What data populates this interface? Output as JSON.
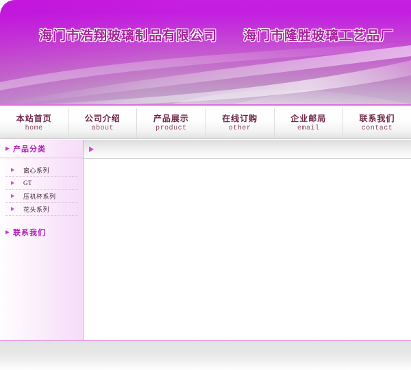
{
  "banner": {
    "title_primary": "海门市浩翔玻璃制品有限公司",
    "title_secondary": "海门市隆胜玻璃工艺品厂",
    "accent_color": "#c81ee0",
    "title_color": "#a81f9e"
  },
  "nav": {
    "items": [
      {
        "cn": "本站首页",
        "en": "home"
      },
      {
        "cn": "公司介绍",
        "en": "about"
      },
      {
        "cn": "产品展示",
        "en": "product"
      },
      {
        "cn": "在线订购",
        "en": "other"
      },
      {
        "cn": "企业邮局",
        "en": "email"
      },
      {
        "cn": "联系我们",
        "en": "contact"
      }
    ]
  },
  "sidebar": {
    "heading_products": "产品分类",
    "heading_contact": "联系我们",
    "categories": [
      {
        "label": "离心系列"
      },
      {
        "label": "GT"
      },
      {
        "label": "压机杯系列"
      },
      {
        "label": "花头系列"
      }
    ],
    "bullet_icon": "triangle-right-icon",
    "accent_color": "#b11fb8"
  },
  "main": {
    "marker_icon": "triangle-right-icon",
    "body_text": ""
  },
  "footer": {
    "text": ""
  }
}
